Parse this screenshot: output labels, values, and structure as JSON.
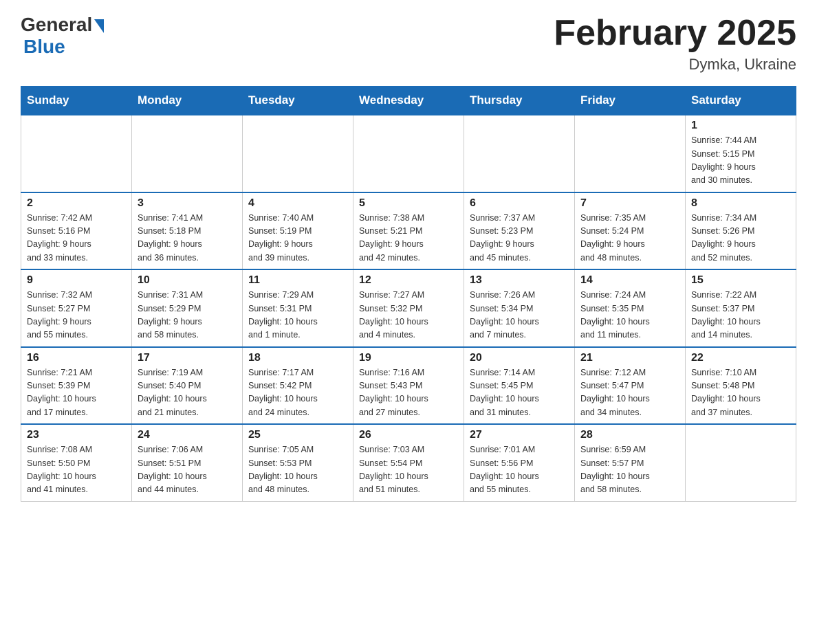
{
  "header": {
    "logo_general": "General",
    "logo_blue": "Blue",
    "title": "February 2025",
    "subtitle": "Dymka, Ukraine"
  },
  "days_of_week": [
    "Sunday",
    "Monday",
    "Tuesday",
    "Wednesday",
    "Thursday",
    "Friday",
    "Saturday"
  ],
  "weeks": [
    [
      {
        "num": "",
        "info": ""
      },
      {
        "num": "",
        "info": ""
      },
      {
        "num": "",
        "info": ""
      },
      {
        "num": "",
        "info": ""
      },
      {
        "num": "",
        "info": ""
      },
      {
        "num": "",
        "info": ""
      },
      {
        "num": "1",
        "info": "Sunrise: 7:44 AM\nSunset: 5:15 PM\nDaylight: 9 hours\nand 30 minutes."
      }
    ],
    [
      {
        "num": "2",
        "info": "Sunrise: 7:42 AM\nSunset: 5:16 PM\nDaylight: 9 hours\nand 33 minutes."
      },
      {
        "num": "3",
        "info": "Sunrise: 7:41 AM\nSunset: 5:18 PM\nDaylight: 9 hours\nand 36 minutes."
      },
      {
        "num": "4",
        "info": "Sunrise: 7:40 AM\nSunset: 5:19 PM\nDaylight: 9 hours\nand 39 minutes."
      },
      {
        "num": "5",
        "info": "Sunrise: 7:38 AM\nSunset: 5:21 PM\nDaylight: 9 hours\nand 42 minutes."
      },
      {
        "num": "6",
        "info": "Sunrise: 7:37 AM\nSunset: 5:23 PM\nDaylight: 9 hours\nand 45 minutes."
      },
      {
        "num": "7",
        "info": "Sunrise: 7:35 AM\nSunset: 5:24 PM\nDaylight: 9 hours\nand 48 minutes."
      },
      {
        "num": "8",
        "info": "Sunrise: 7:34 AM\nSunset: 5:26 PM\nDaylight: 9 hours\nand 52 minutes."
      }
    ],
    [
      {
        "num": "9",
        "info": "Sunrise: 7:32 AM\nSunset: 5:27 PM\nDaylight: 9 hours\nand 55 minutes."
      },
      {
        "num": "10",
        "info": "Sunrise: 7:31 AM\nSunset: 5:29 PM\nDaylight: 9 hours\nand 58 minutes."
      },
      {
        "num": "11",
        "info": "Sunrise: 7:29 AM\nSunset: 5:31 PM\nDaylight: 10 hours\nand 1 minute."
      },
      {
        "num": "12",
        "info": "Sunrise: 7:27 AM\nSunset: 5:32 PM\nDaylight: 10 hours\nand 4 minutes."
      },
      {
        "num": "13",
        "info": "Sunrise: 7:26 AM\nSunset: 5:34 PM\nDaylight: 10 hours\nand 7 minutes."
      },
      {
        "num": "14",
        "info": "Sunrise: 7:24 AM\nSunset: 5:35 PM\nDaylight: 10 hours\nand 11 minutes."
      },
      {
        "num": "15",
        "info": "Sunrise: 7:22 AM\nSunset: 5:37 PM\nDaylight: 10 hours\nand 14 minutes."
      }
    ],
    [
      {
        "num": "16",
        "info": "Sunrise: 7:21 AM\nSunset: 5:39 PM\nDaylight: 10 hours\nand 17 minutes."
      },
      {
        "num": "17",
        "info": "Sunrise: 7:19 AM\nSunset: 5:40 PM\nDaylight: 10 hours\nand 21 minutes."
      },
      {
        "num": "18",
        "info": "Sunrise: 7:17 AM\nSunset: 5:42 PM\nDaylight: 10 hours\nand 24 minutes."
      },
      {
        "num": "19",
        "info": "Sunrise: 7:16 AM\nSunset: 5:43 PM\nDaylight: 10 hours\nand 27 minutes."
      },
      {
        "num": "20",
        "info": "Sunrise: 7:14 AM\nSunset: 5:45 PM\nDaylight: 10 hours\nand 31 minutes."
      },
      {
        "num": "21",
        "info": "Sunrise: 7:12 AM\nSunset: 5:47 PM\nDaylight: 10 hours\nand 34 minutes."
      },
      {
        "num": "22",
        "info": "Sunrise: 7:10 AM\nSunset: 5:48 PM\nDaylight: 10 hours\nand 37 minutes."
      }
    ],
    [
      {
        "num": "23",
        "info": "Sunrise: 7:08 AM\nSunset: 5:50 PM\nDaylight: 10 hours\nand 41 minutes."
      },
      {
        "num": "24",
        "info": "Sunrise: 7:06 AM\nSunset: 5:51 PM\nDaylight: 10 hours\nand 44 minutes."
      },
      {
        "num": "25",
        "info": "Sunrise: 7:05 AM\nSunset: 5:53 PM\nDaylight: 10 hours\nand 48 minutes."
      },
      {
        "num": "26",
        "info": "Sunrise: 7:03 AM\nSunset: 5:54 PM\nDaylight: 10 hours\nand 51 minutes."
      },
      {
        "num": "27",
        "info": "Sunrise: 7:01 AM\nSunset: 5:56 PM\nDaylight: 10 hours\nand 55 minutes."
      },
      {
        "num": "28",
        "info": "Sunrise: 6:59 AM\nSunset: 5:57 PM\nDaylight: 10 hours\nand 58 minutes."
      },
      {
        "num": "",
        "info": ""
      }
    ]
  ]
}
